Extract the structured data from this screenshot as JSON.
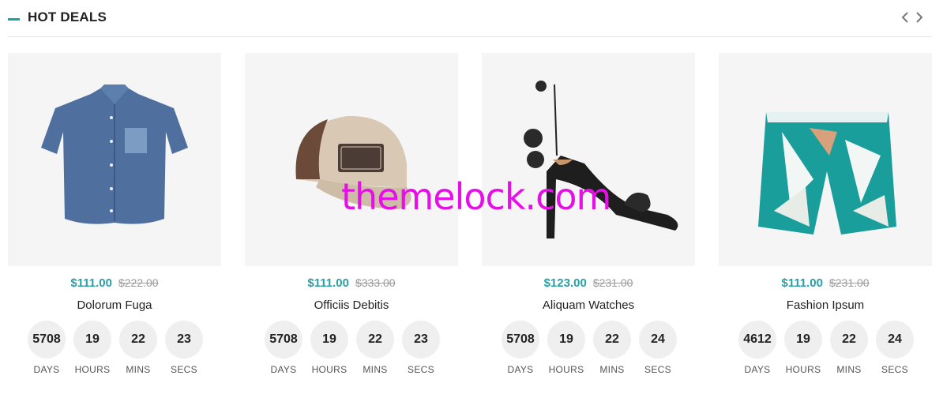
{
  "section": {
    "title": "HOT DEALS"
  },
  "nav": {
    "prev_icon": "chevron-left-icon",
    "next_icon": "chevron-right-icon"
  },
  "colors": {
    "accent": "#1aa1a1",
    "price": "#2a9fa5",
    "old_price": "#9a9a9a",
    "watermark": "#e610e6"
  },
  "watermark": "themelock.com",
  "products": [
    {
      "name": "Dolorum Fuga",
      "price": "$111.00",
      "old_price": "$222.00",
      "image_icon": "denim-shirt-image",
      "countdown": [
        {
          "value": "5708",
          "label": "DAYS"
        },
        {
          "value": "19",
          "label": "HOURS"
        },
        {
          "value": "22",
          "label": "MINS"
        },
        {
          "value": "23",
          "label": "SECS"
        }
      ]
    },
    {
      "name": "Officiis Debitis",
      "price": "$111.00",
      "old_price": "$333.00",
      "image_icon": "baseball-cap-image",
      "countdown": [
        {
          "value": "5708",
          "label": "DAYS"
        },
        {
          "value": "19",
          "label": "HOURS"
        },
        {
          "value": "22",
          "label": "MINS"
        },
        {
          "value": "23",
          "label": "SECS"
        }
      ]
    },
    {
      "name": "Aliquam Watches",
      "price": "$123.00",
      "old_price": "$231.00",
      "image_icon": "heeled-sandal-image",
      "countdown": [
        {
          "value": "5708",
          "label": "DAYS"
        },
        {
          "value": "19",
          "label": "HOURS"
        },
        {
          "value": "22",
          "label": "MINS"
        },
        {
          "value": "24",
          "label": "SECS"
        }
      ]
    },
    {
      "name": "Fashion Ipsum",
      "price": "$111.00",
      "old_price": "$231.00",
      "image_icon": "print-shorts-image",
      "countdown": [
        {
          "value": "4612",
          "label": "DAYS"
        },
        {
          "value": "19",
          "label": "HOURS"
        },
        {
          "value": "22",
          "label": "MINS"
        },
        {
          "value": "24",
          "label": "SECS"
        }
      ]
    }
  ]
}
